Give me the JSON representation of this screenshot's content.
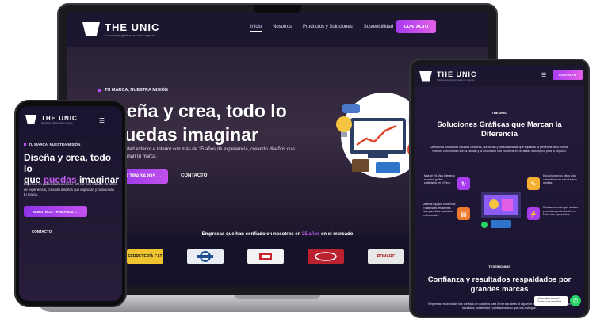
{
  "brand": {
    "name": "THE UNIC",
    "tagline": "Soluciones gráficas para tu negocio"
  },
  "laptop": {
    "nav": {
      "items": [
        "Inicio",
        "Nosotros",
        "Productos y Soluciones",
        "Sostenibilidad"
      ],
      "cta": "CONTACTO"
    },
    "hero": {
      "eyebrow": "TU MARCA, NUESTRA MISIÓN",
      "title_line1": "Diseña y crea, todo lo",
      "title_line2": "e puedas imaginar",
      "desc_line1": "ublicidad exterior e interior con más de 25 años de experiencia, creando diseños que",
      "desc_line2": "osicionan tu marca.",
      "btn_primary": "S TRABAJOS →",
      "btn_secondary": "CONTACTO"
    },
    "brands": {
      "title_prefix": "Empresas que han confiado en nosotros en",
      "title_highlight": "25 años",
      "title_suffix": "en el mercado",
      "logos": [
        "FERRETERÍA CAT",
        "Logo 2",
        "Logo 3",
        "Logo 4",
        "ROMARC"
      ]
    }
  },
  "phone": {
    "eyebrow": "TU MARCA, NUESTRA MISIÓN",
    "title_a": "Diseña y crea, todo lo",
    "title_b": "que",
    "title_hl": "puedas",
    "title_c": "imaginar",
    "desc": "Expertos en publicidad exterior e interior con más de 25 años de experiencia, creando diseños que impactan y posicionan tu marca.",
    "btn_primary": "NUESTROS TRABAJOS →",
    "btn_secondary": "CONTACTO"
  },
  "tablet": {
    "nav_cta": "CONTACTO",
    "tag": "THE UNIC",
    "title": "Soluciones Gráficas que Marcan la Diferencia",
    "desc": "Ofrecemos soluciones visuales creativas, duraderas y personalizadas que impulsan la presencia de tu marca. Nuestro compromiso con la calidad y la innovación nos convierte en un aliado estratégico para tu negocio.",
    "feat_left_1": "Más de 25 años liderando el sector gráfico publicitario en el Perú.",
    "feat_left_2": "Usamos equipos modernos y materiales resistentes para garantizar acabados profesionales.",
    "feat_right_1": "Escuchamos tus ideas y las convertimos en soluciones a medida.",
    "feat_right_2": "Realizamos entregas rápidas y montajes profesionales en todo Lima y provincias.",
    "tag2": "TESTIMONIOS",
    "title2": "Confianza y resultados respaldados por grandes marcas",
    "desc2": "Empresas reconocidas han confiado en nosotros para llevar sus ideas al siguiente nivel. Sus testimonios reflejan la calidad, creatividad y profesionalismo que nos distingue.",
    "whatsapp_bubble": "¿Necesitas ayuda? Chatea con nosotros"
  },
  "colors": {
    "accent": "#b84cf5",
    "bg": "#1a1430",
    "whatsapp": "#25d366"
  }
}
